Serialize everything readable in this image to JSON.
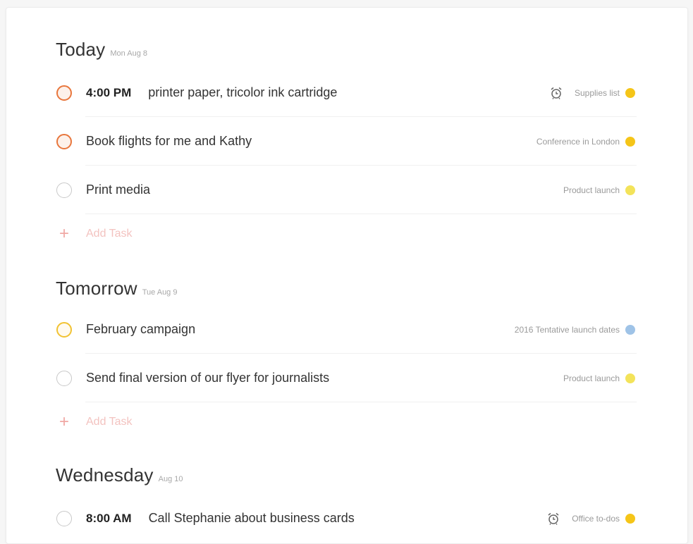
{
  "sections": [
    {
      "title": "Today",
      "date": "Mon Aug 8",
      "add_task_label": "Add Task",
      "tasks": [
        {
          "time": "4:00 PM",
          "text": "printer paper, tricolor ink cartridge",
          "project": "Supplies list",
          "project_color": "#f5c518",
          "priority_color": "#e8763c",
          "has_reminder": true
        },
        {
          "time": "",
          "text": "Book flights for me and Kathy",
          "project": "Conference in London",
          "project_color": "#f5c518",
          "priority_color": "#e8763c",
          "has_reminder": false
        },
        {
          "time": "",
          "text": "Print media",
          "project": "Product launch",
          "project_color": "#f3e35a",
          "priority_color": "",
          "has_reminder": false
        }
      ]
    },
    {
      "title": "Tomorrow",
      "date": "Tue Aug 9",
      "add_task_label": "Add Task",
      "tasks": [
        {
          "time": "",
          "text": "February campaign",
          "project": "2016 Tentative launch dates",
          "project_color": "#9fc3e7",
          "priority_color": "#f1c232",
          "has_reminder": false
        },
        {
          "time": "",
          "text": "Send final version of our flyer for journalists",
          "project": "Product launch",
          "project_color": "#f3e35a",
          "priority_color": "",
          "has_reminder": false
        }
      ]
    },
    {
      "title": "Wednesday",
      "date": "Aug 10",
      "tasks": [
        {
          "time": "8:00 AM",
          "text": "Call Stephanie about business cards",
          "project": "Office to-dos",
          "project_color": "#f5c518",
          "priority_color": "",
          "has_reminder": true
        }
      ]
    }
  ]
}
